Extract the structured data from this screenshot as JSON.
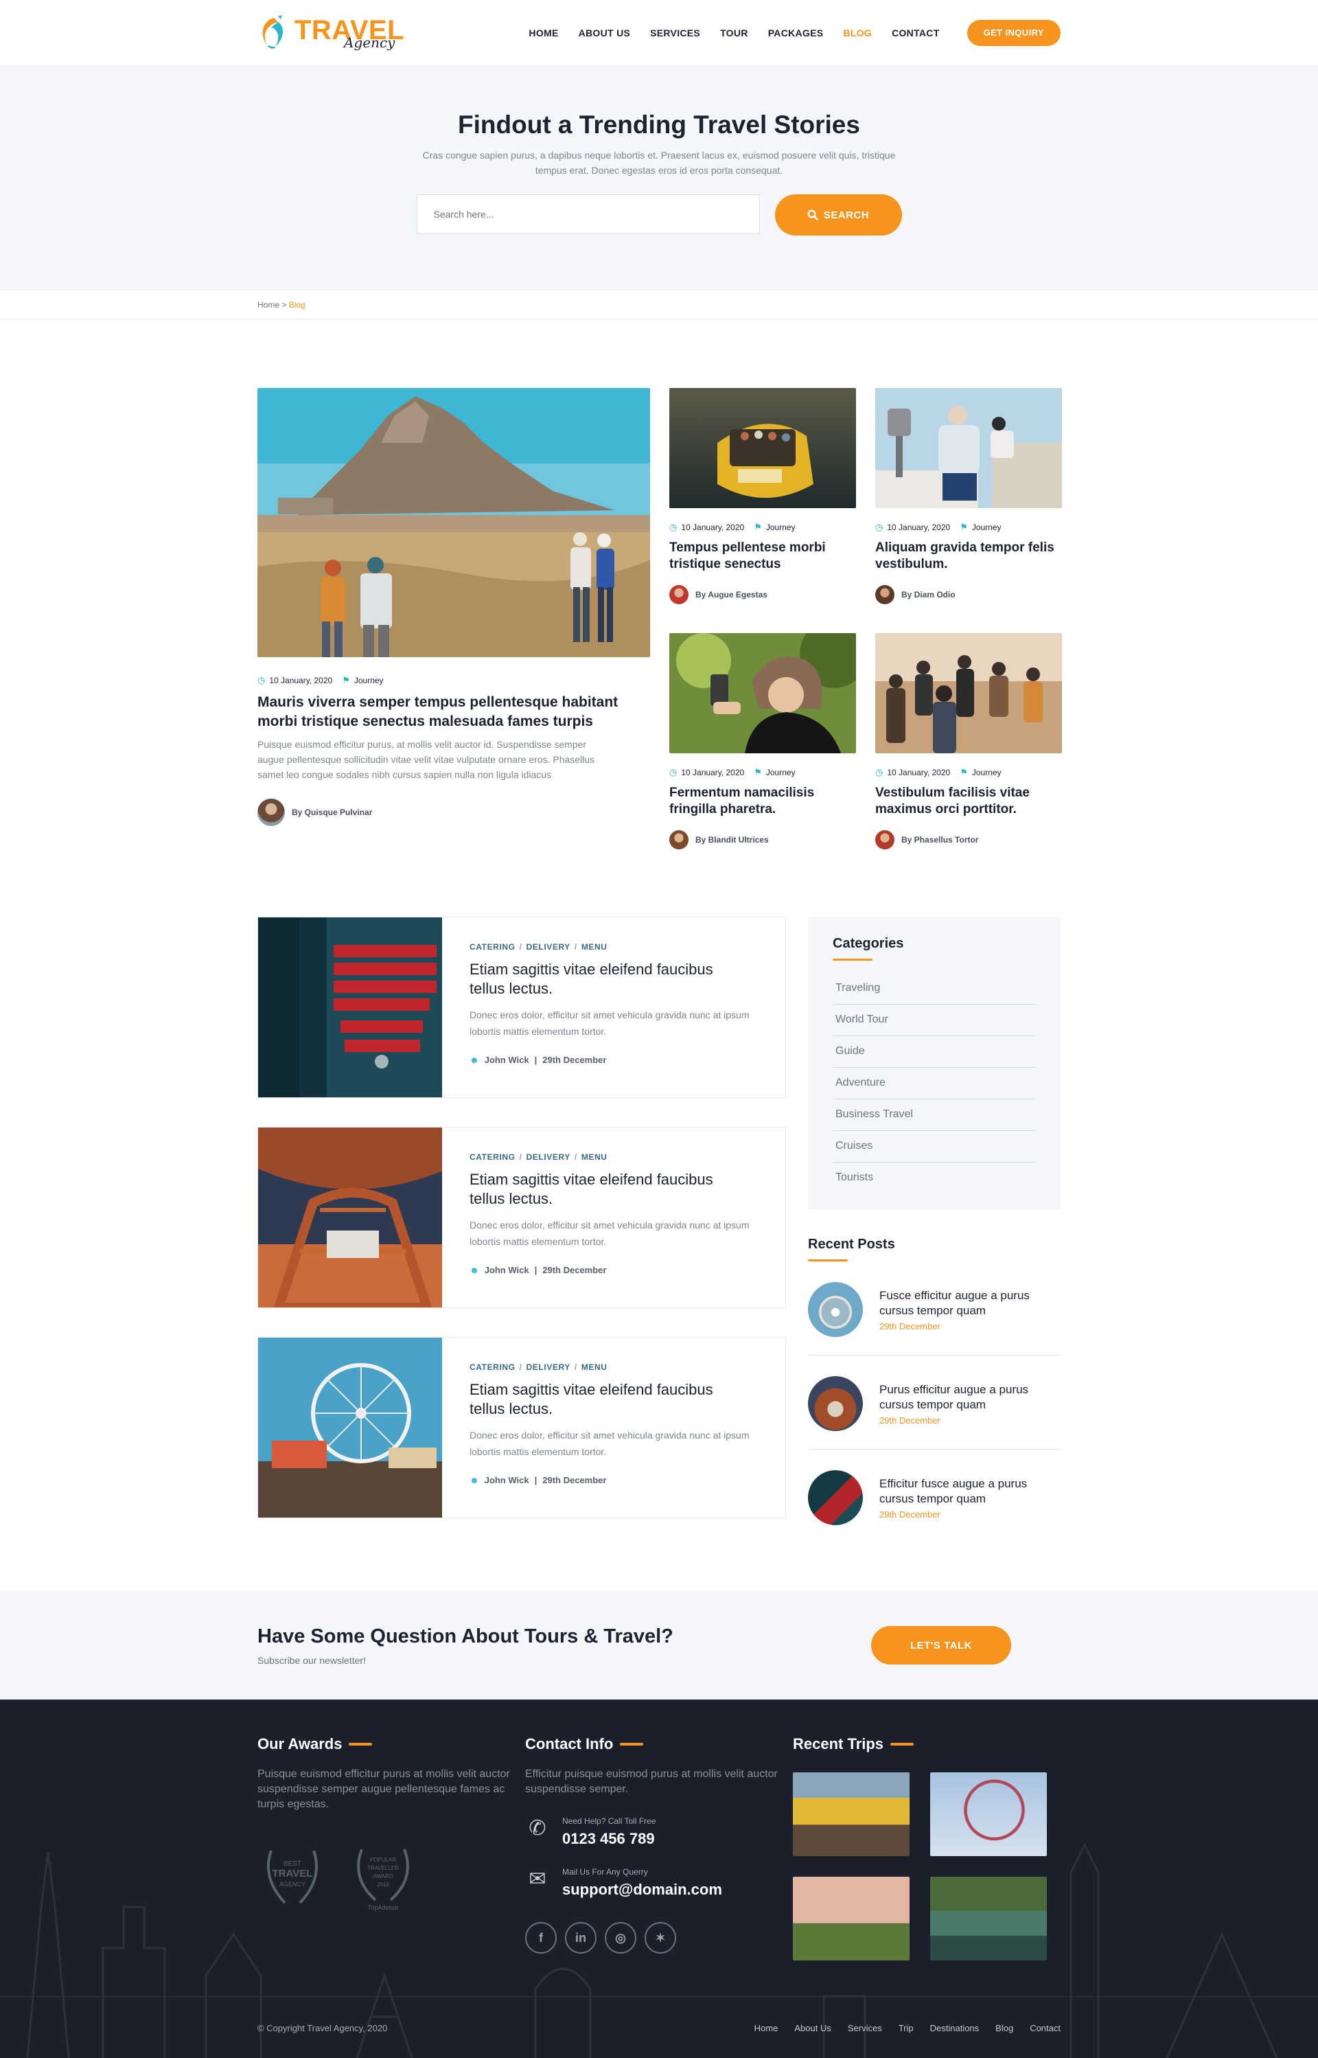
{
  "brand": {
    "title": "TRAVEL",
    "subtitle": "Agency",
    "accent": "#f7941d",
    "teal": "#2bb7c9",
    "dark": "#1b1f2b"
  },
  "nav": {
    "items": [
      "HOME",
      "ABOUT US",
      "SERVICES",
      "TOUR",
      "PACKAGES",
      "BLOG",
      "CONTACT"
    ],
    "active": "BLOG",
    "cta": "GET INQUIRY"
  },
  "hero": {
    "title": "Findout a Trending Travel Stories",
    "text": "Cras congue sapien purus, a dapibus neque lobortis et. Praesent lacus ex, euismod posuere velit quis, tristique tempus erat. Donec egestas eros id eros porta consequat.",
    "search_placeholder": "Search here...",
    "search_button": "SEARCH"
  },
  "breadcrumb": {
    "home": "Home",
    "sep": " > ",
    "current": "Blog"
  },
  "featured": {
    "main": {
      "date": "10 January, 2020",
      "tag": "Journey",
      "title": "Mauris viverra semper tempus pellentesque habitant morbi tristique senectus malesuada fames turpis",
      "excerpt": "Puisque euismod efficitur purus, at mollis velit auctor id. Suspendisse semper augue pellentesque sollicitudin vitae velit vitae vulputate ornare eros. Phasellus samet leo congue sodales nibh cursus sapien nulla non ligula idiacus",
      "author": "By Quisque Pulvinar"
    },
    "cards": [
      {
        "date": "10 January, 2020",
        "tag": "Journey",
        "title": "Tempus pellentese morbi tristique senectus",
        "author": "By Augue Egestas"
      },
      {
        "date": "10 January, 2020",
        "tag": "Journey",
        "title": "Aliquam gravida tempor felis vestibulum.",
        "author": "By Diam Odio"
      },
      {
        "date": "10 January, 2020",
        "tag": "Journey",
        "title": "Fermentum namacilisis fringilla pharetra.",
        "author": "By Blandit Ultrices"
      },
      {
        "date": "10 January, 2020",
        "tag": "Journey",
        "title": "Vestibulum facilisis vitae maximus orci porttitor.",
        "author": "By Phasellus Tortor"
      }
    ]
  },
  "posts": [
    {
      "tags": [
        "CATERING",
        "DELIVERY",
        "MENU"
      ],
      "title": "Etiam sagittis vitae eleifend faucibus tellus lectus.",
      "excerpt": "Donec eros dolor, efficitur sit amet vehicula gravida nunc at ipsum lobortis mattis elementum tortor.",
      "author": "John Wick",
      "date": "29th December"
    },
    {
      "tags": [
        "CATERING",
        "DELIVERY",
        "MENU"
      ],
      "title": "Etiam sagittis vitae eleifend faucibus tellus lectus.",
      "excerpt": "Donec eros dolor, efficitur sit amet vehicula gravida nunc at ipsum lobortis mattis elementum tortor.",
      "author": "John Wick",
      "date": "29th December"
    },
    {
      "tags": [
        "CATERING",
        "DELIVERY",
        "MENU"
      ],
      "title": "Etiam sagittis vitae eleifend faucibus tellus lectus.",
      "excerpt": "Donec eros dolor, efficitur sit amet vehicula gravida nunc at ipsum lobortis mattis elementum tortor.",
      "author": "John Wick",
      "date": "29th December"
    }
  ],
  "sidebar": {
    "categories_title": "Categories",
    "categories": [
      "Traveling",
      "World Tour",
      "Guide",
      "Adventure",
      "Business Travel",
      "Cruises",
      "Tourists"
    ],
    "recent_title": "Recent Posts",
    "recent": [
      {
        "title": "Fusce efficitur augue a purus cursus tempor quam",
        "date": "29th December"
      },
      {
        "title": "Purus efficitur augue a purus cursus tempor quam",
        "date": "29th December"
      },
      {
        "title": "Efficitur fusce augue a purus cursus tempor quam",
        "date": "29th December"
      }
    ]
  },
  "cta": {
    "title": "Have Some Question About Tours & Travel?",
    "subtitle": "Subscribe our newsletter!",
    "button": "LET'S TALK"
  },
  "footer": {
    "awards_title": "Our Awards",
    "awards_text": "Puisque euismod efficitur purus at mollis velit auctor suspendisse semper augue pellentesque fames ac turpis egestas.",
    "award1": [
      "BEST",
      "TRAVEL",
      "AGENCY"
    ],
    "award2": [
      "POPULAR",
      "TRAVELLER",
      "AWARD",
      "2016",
      "TripAdvisor"
    ],
    "contact_title": "Contact Info",
    "contact_text": "Efficitur puisque euismod purus at mollis velit auctor suspendisse semper.",
    "phone_label": "Need Help? Call Toll Free",
    "phone": "0123 456 789",
    "mail_label": "Mail Us For Any Querry",
    "mail": "support@domain.com",
    "socials": [
      "facebook-icon",
      "linkedin-icon",
      "instagram-icon",
      "twitter-icon"
    ],
    "trips_title": "Recent Trips",
    "copyright": "© Copyright Travel Agency, 2020",
    "links": [
      "Home",
      "About Us",
      "Services",
      "Trip",
      "Destinations",
      "Blog",
      "Contact"
    ]
  }
}
